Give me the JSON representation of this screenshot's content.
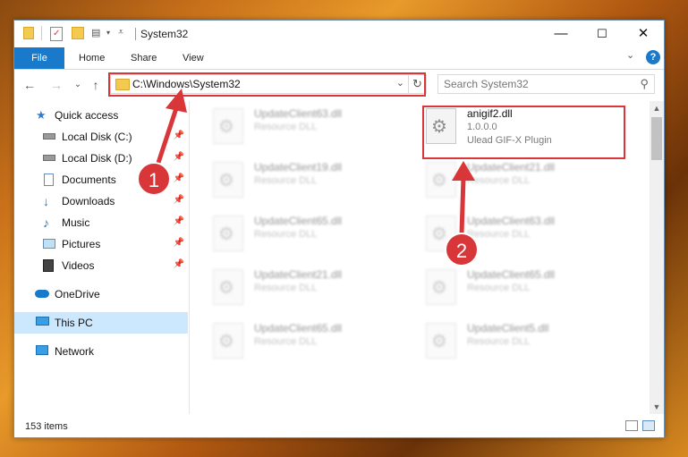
{
  "window": {
    "title": "System32",
    "controls": {
      "minimize": "—",
      "maximize": "☐",
      "close": "✕"
    }
  },
  "ribbon": {
    "tabs": [
      "File",
      "Home",
      "Share",
      "View"
    ],
    "expand_chevron": "⌄",
    "help": "?"
  },
  "address_bar": {
    "path": "C:\\Windows\\System32",
    "dropdown": "⌄",
    "refresh": "↻"
  },
  "search": {
    "placeholder": "Search System32"
  },
  "nav": {
    "back": "←",
    "forward": "→",
    "recent": "⌄",
    "up": "↑",
    "items": [
      {
        "label": "Quick access",
        "icon": "star-icon",
        "pinned": false
      },
      {
        "label": "Local Disk (C:)",
        "icon": "drive-icon",
        "pinned": true
      },
      {
        "label": "Local Disk (D:)",
        "icon": "drive-icon",
        "pinned": true
      },
      {
        "label": "Documents",
        "icon": "documents-icon",
        "pinned": true
      },
      {
        "label": "Downloads",
        "icon": "downloads-icon",
        "pinned": true
      },
      {
        "label": "Music",
        "icon": "music-icon",
        "pinned": true
      },
      {
        "label": "Pictures",
        "icon": "pictures-icon",
        "pinned": true
      },
      {
        "label": "Videos",
        "icon": "videos-icon",
        "pinned": true
      },
      {
        "label": "OneDrive",
        "icon": "onedrive-icon",
        "pinned": false
      },
      {
        "label": "This PC",
        "icon": "this-pc-icon",
        "pinned": false,
        "selected": true
      },
      {
        "label": "Network",
        "icon": "network-icon",
        "pinned": false
      }
    ]
  },
  "files": {
    "highlighted": {
      "name": "anigif2.dll",
      "version": "1.0.0.0",
      "description": "Ulead GIF-X Plugin"
    },
    "left_column": [
      {
        "name": "UpdateClient63.dll",
        "type": "Resource DLL"
      },
      {
        "name": "UpdateClient19.dll",
        "type": "Resource DLL"
      },
      {
        "name": "UpdateClient65.dll",
        "type": "Resource DLL"
      },
      {
        "name": "UpdateClient21.dll",
        "type": "Resource DLL"
      },
      {
        "name": "UpdateClient65.dll",
        "type": "Resource DLL"
      }
    ],
    "right_column": [
      {
        "name": "UpdateClient21.dll",
        "type": "Resource DLL"
      },
      {
        "name": "UpdateClient63.dll",
        "type": "Resource DLL"
      },
      {
        "name": "UpdateClient65.dll",
        "type": "Resource DLL"
      },
      {
        "name": "UpdateClient5.dll",
        "type": "Resource DLL"
      }
    ]
  },
  "status": {
    "item_count": "153 items"
  },
  "annotations": {
    "step1": "1",
    "step2": "2",
    "accent_color": "#d9363a"
  }
}
